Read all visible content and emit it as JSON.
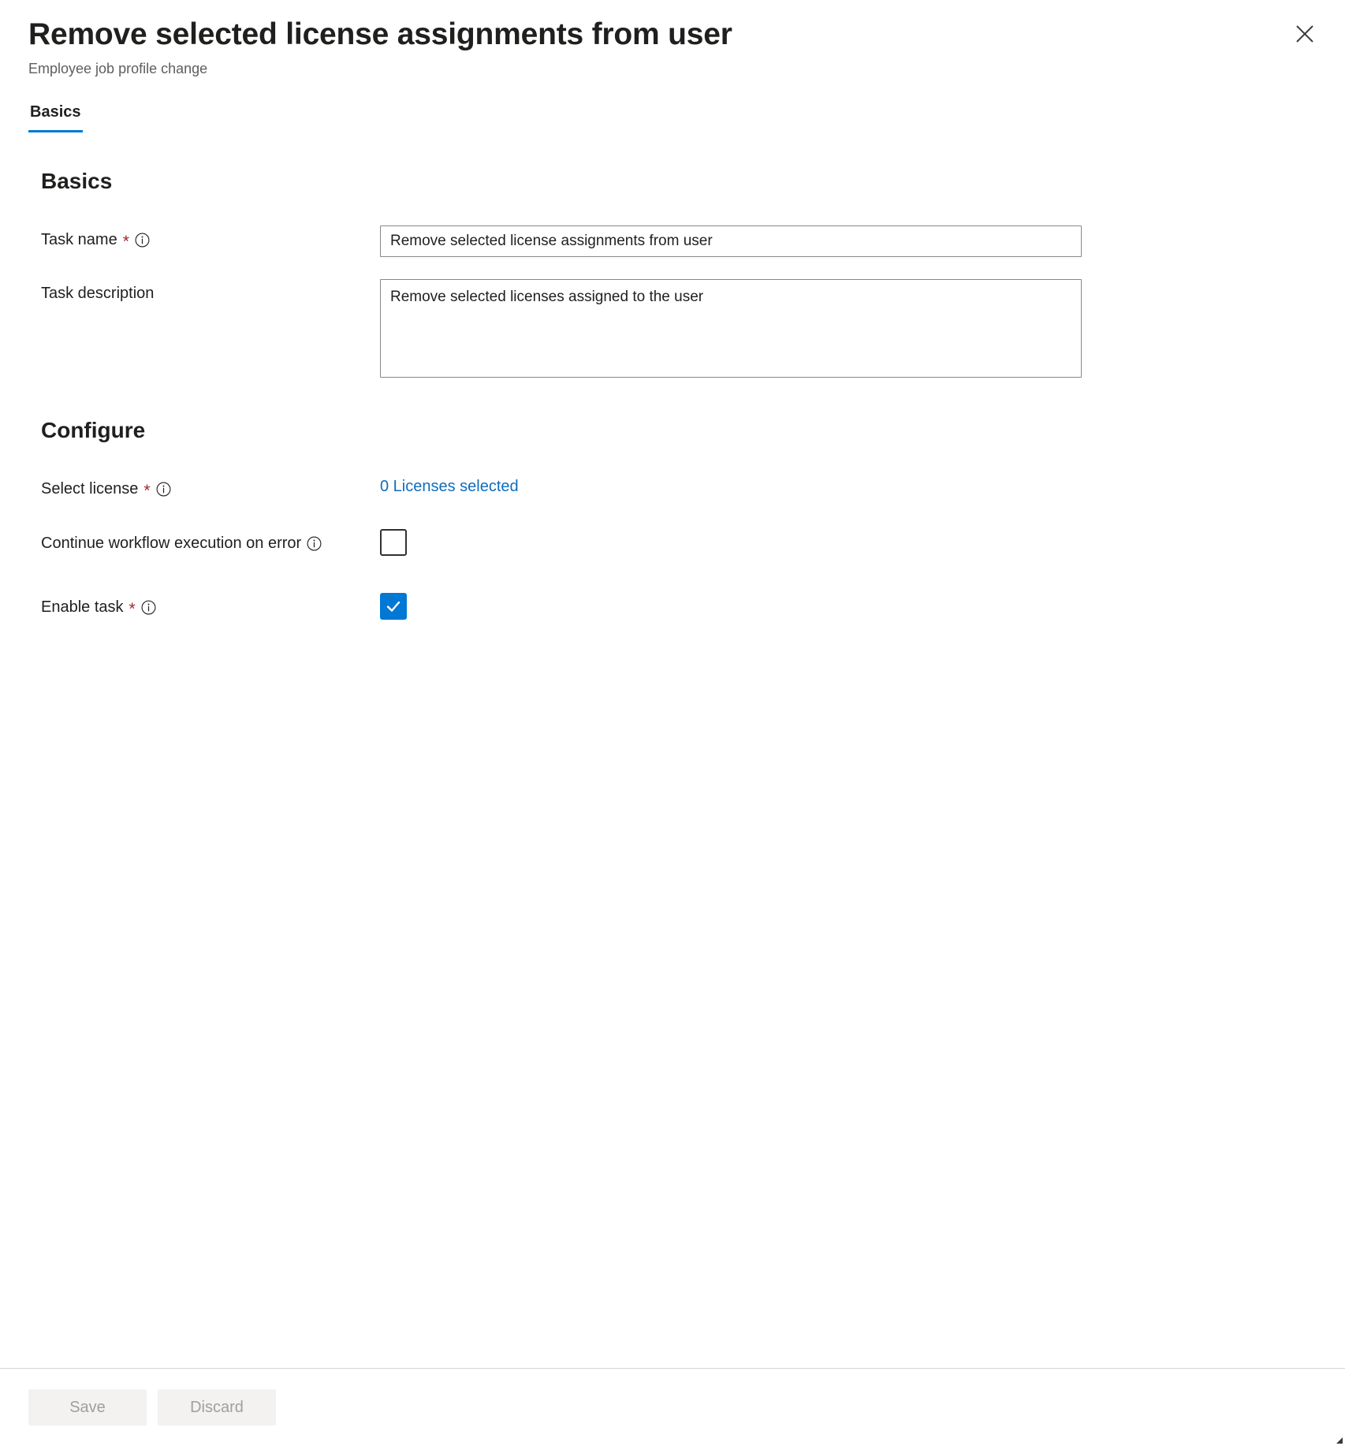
{
  "header": {
    "title": "Remove selected license assignments from user",
    "subtitle": "Employee job profile change",
    "close_label": "Close",
    "close_icon": "close-icon"
  },
  "tabs": [
    {
      "label": "Basics",
      "active": true
    }
  ],
  "sections": {
    "basics": {
      "heading": "Basics",
      "fields": {
        "task_name": {
          "label": "Task name",
          "required_marker": "*",
          "info_icon": "info-icon",
          "value": "Remove selected license assignments from user",
          "placeholder": ""
        },
        "task_description": {
          "label": "Task description",
          "value": "Remove selected licenses assigned to the user",
          "placeholder": ""
        }
      }
    },
    "configure": {
      "heading": "Configure",
      "fields": {
        "select_license": {
          "label": "Select license",
          "required_marker": "*",
          "info_icon": "info-icon",
          "link_text": "0 Licenses selected",
          "selected_count": 0
        },
        "continue_on_error": {
          "label": "Continue workflow execution on error",
          "info_icon": "info-icon",
          "checked": false
        },
        "enable_task": {
          "label": "Enable task",
          "required_marker": "*",
          "info_icon": "info-icon",
          "checked": true
        }
      }
    }
  },
  "footer": {
    "save_label": "Save",
    "discard_label": "Discard",
    "save_disabled": true,
    "discard_disabled": true
  },
  "colors": {
    "accent": "#0078d4",
    "link": "#0f6cbd",
    "required": "#a4262c",
    "text": "#201f1e",
    "subtle_text": "#605e5c",
    "border": "#8a8886",
    "disabled_button_bg": "#f3f2f1",
    "disabled_button_text": "#a19f9d"
  }
}
